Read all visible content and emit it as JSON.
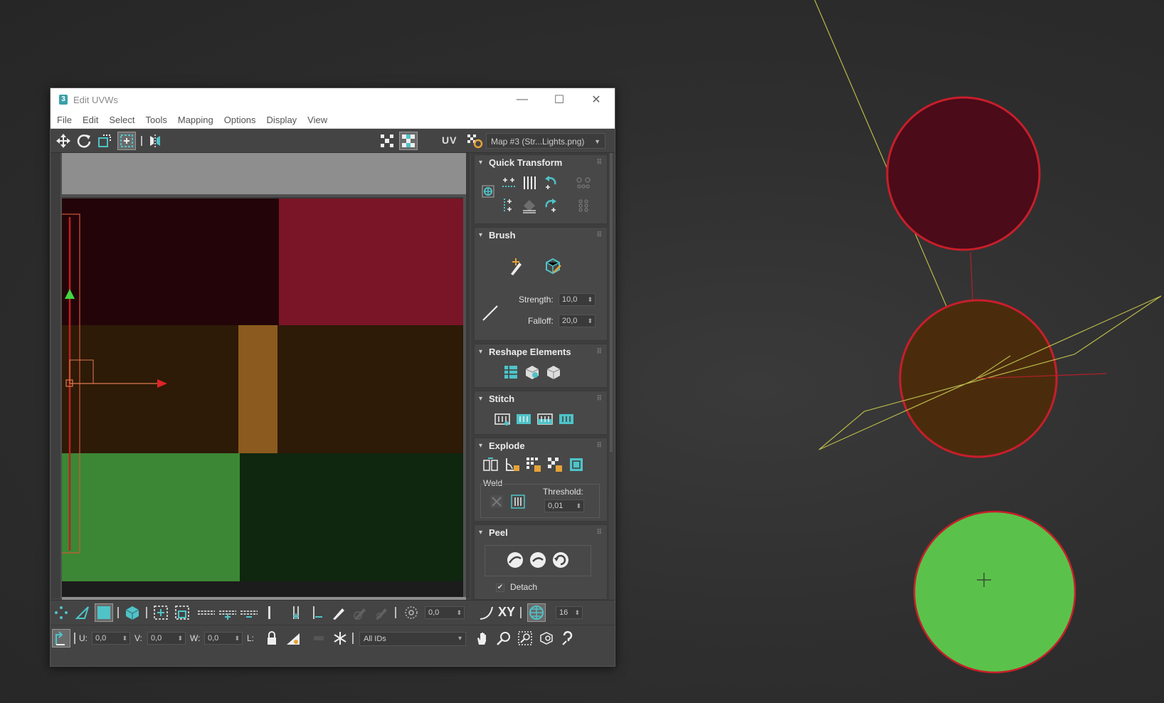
{
  "window": {
    "title": "Edit UVWs",
    "app_icon_glyph": "3",
    "controls": {
      "minimize": "—",
      "maximize": "☐",
      "close": "✕"
    }
  },
  "menu": [
    "File",
    "Edit",
    "Select",
    "Tools",
    "Mapping",
    "Options",
    "Display",
    "View"
  ],
  "toolbar": {
    "uv_label": "UV",
    "map_selector": "Map #3 (Str...Lights.png)"
  },
  "rollouts": {
    "quick_transform": {
      "title": "Quick Transform"
    },
    "brush": {
      "title": "Brush",
      "strength_label": "Strength:",
      "strength_value": "10,0",
      "falloff_label": "Falloff:",
      "falloff_value": "20,0"
    },
    "reshape": {
      "title": "Reshape Elements"
    },
    "stitch": {
      "title": "Stitch"
    },
    "explode": {
      "title": "Explode",
      "weld_label": "Weld",
      "threshold_label": "Threshold:",
      "threshold_value": "0,01"
    },
    "peel": {
      "title": "Peel",
      "detach_label": "Detach",
      "detach_checked": true
    }
  },
  "bottom_bar": {
    "soft_value": "0,0",
    "xy_label": "XY",
    "grid_value": "16",
    "u_label": "U:",
    "u_value": "0,0",
    "v_label": "V:",
    "v_value": "0,0",
    "w_label": "W:",
    "w_value": "0,0",
    "l_label": "L:",
    "ids_filter": "All IDs"
  },
  "colors": {
    "accent_cyan": "#4fc3c8",
    "red_light": "#4a0a18",
    "amber_light": "#4a2a0c",
    "green_light": "#5ac24a",
    "selection_red": "#e0202a"
  }
}
